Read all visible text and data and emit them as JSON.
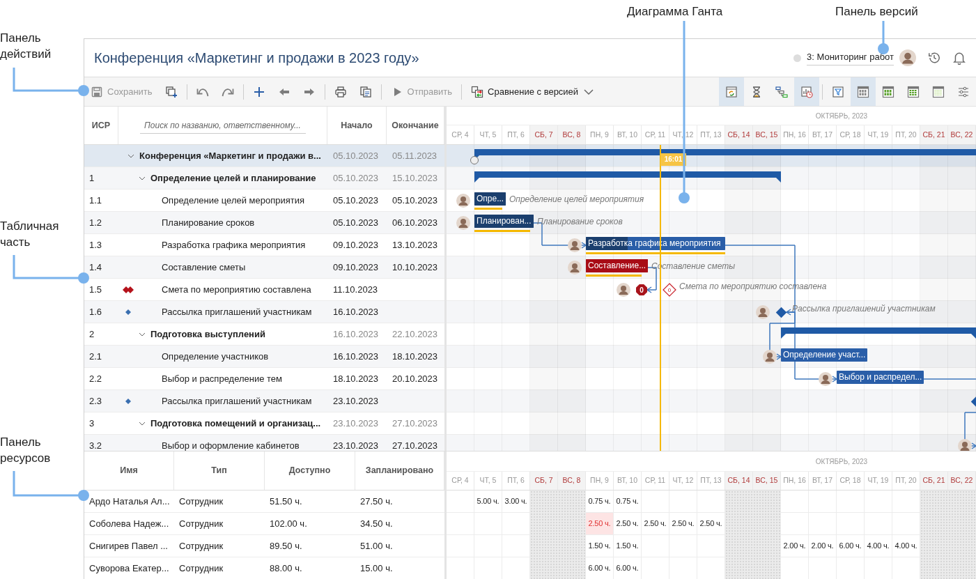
{
  "callouts": [
    {
      "kind": "toolbar",
      "text": "Панель действий"
    },
    {
      "kind": "table",
      "text": "Табличная часть"
    },
    {
      "kind": "resources",
      "text": "Панель ресурсов"
    },
    {
      "kind": "gantt",
      "text": "Диаграмма Ганта"
    },
    {
      "kind": "versions",
      "text": "Панель версий"
    }
  ],
  "header": {
    "title": "Конференция «Маркетинг и продажи в 2023 году»",
    "version": "3: Мониторинг работ"
  },
  "toolbar": {
    "left": [
      [
        {
          "kind": "save",
          "label": "Сохранить",
          "disabled": true
        },
        {
          "kind": "add-copy",
          "disabled": false
        }
      ],
      [
        {
          "kind": "undo",
          "disabled": true
        },
        {
          "kind": "redo",
          "disabled": true
        }
      ],
      [
        {
          "kind": "add",
          "disabled": false
        },
        {
          "kind": "outdent",
          "disabled": true
        },
        {
          "kind": "indent",
          "disabled": true
        }
      ],
      [
        {
          "kind": "print",
          "disabled": false
        },
        {
          "kind": "copy",
          "disabled": false
        }
      ],
      [
        {
          "kind": "send",
          "label": "Отправить",
          "disabled": true
        }
      ],
      [
        {
          "kind": "compare",
          "label": "Сравнение с версией",
          "disabled": false
        }
      ]
    ],
    "right": [
      [
        {
          "kind": "refresh",
          "selected": true
        },
        {
          "kind": "hourglass",
          "selected": false
        },
        {
          "kind": "links",
          "selected": false
        },
        {
          "kind": "chartclock",
          "selected": true
        }
      ],
      [
        {
          "kind": "filter",
          "selected": false
        },
        {
          "kind": "grid-a",
          "selected": true
        },
        {
          "kind": "grid-b",
          "selected": false
        },
        {
          "kind": "grid-c",
          "selected": false
        },
        {
          "kind": "grid-d",
          "selected": false
        },
        {
          "kind": "sliders",
          "selected": false
        }
      ]
    ]
  },
  "table": {
    "columns": [
      {
        "kind": "text",
        "label": "ИСР"
      },
      {
        "kind": "search",
        "placeholder": "Поиск по названию, ответственному..."
      },
      {
        "kind": "text",
        "label": "Начало"
      },
      {
        "kind": "text",
        "label": "Окончание"
      }
    ],
    "tasks": [
      {
        "kind": "summary",
        "name": "Конференция «Маркетинг и продажи в...",
        "start": "05.10.2023",
        "end": "05.11.2023",
        "expanded": true,
        "selected": true,
        "start_marker": true,
        "children": [
          {
            "kind": "summary",
            "wbs": "1",
            "name": "Определение целей и планирование",
            "start": "05.10.2023",
            "end": "15.10.2023",
            "expanded": true,
            "selected": false,
            "children": [
              {
                "kind": "task",
                "wbs": "1.1",
                "name": "Определение целей мероприятия",
                "start": "05.10.2023",
                "end": "05.10.2023",
                "selected": false,
                "avatar": true,
                "bar": {
                  "label": "Опре...",
                  "level": 1,
                  "overdue": false,
                  "note": "Определение целей мероприятия",
                  "baseline": true
                }
              },
              {
                "kind": "task",
                "wbs": "1.2",
                "name": "Планирование сроков",
                "start": "05.10.2023",
                "end": "06.10.2023",
                "selected": false,
                "avatar": true,
                "bar": {
                  "label": "Планирован...",
                  "level": 1,
                  "overdue": false,
                  "note": "Планирование сроков",
                  "baseline": true
                }
              },
              {
                "kind": "task",
                "wbs": "1.3",
                "name": "Разработка графика мероприятия",
                "start": "09.10.2023",
                "end": "13.10.2023",
                "selected": false,
                "avatar": true,
                "bar": {
                  "label": "Разработка графика мероприятия",
                  "level": 0.3,
                  "overdue": false,
                  "baseline": true
                }
              },
              {
                "kind": "task",
                "wbs": "1.4",
                "name": "Составление сметы",
                "start": "09.10.2023",
                "end": "10.10.2023",
                "selected": false,
                "avatar": true,
                "bar": {
                  "label": "Составление...",
                  "level": 1,
                  "overdue": true,
                  "note": "Составление сметы",
                  "baseline": true
                }
              },
              {
                "kind": "milestone",
                "wbs": "1.5",
                "name": "Смета по мероприятию составлена",
                "start": "11.10.2023",
                "selected": false,
                "critical": true,
                "avatar": true,
                "bar": {
                  "badge": "0",
                  "note": "Смета по мероприятию составлена",
                  "baseline": {
                    "badge": "0"
                  }
                }
              },
              {
                "kind": "milestone",
                "wbs": "1.6",
                "name": "Рассылка приглашений участникам",
                "start": "16.10.2023",
                "selected": false,
                "critical": false,
                "avatar": true,
                "bar": {
                  "note": "Рассылка приглашений участникам"
                }
              }
            ]
          },
          {
            "kind": "summary",
            "wbs": "2",
            "name": "Подготовка выступлений",
            "start": "16.10.2023",
            "end": "22.10.2023",
            "expanded": true,
            "selected": false,
            "children": [
              {
                "kind": "task",
                "wbs": "2.1",
                "name": "Определение участников",
                "start": "16.10.2023",
                "end": "18.10.2023",
                "selected": false,
                "avatar": true,
                "bar": {
                  "label": "Определение участ...",
                  "overdue": false
                }
              },
              {
                "kind": "task",
                "wbs": "2.2",
                "name": "Выбор и распределение тем",
                "start": "18.10.2023",
                "end": "20.10.2023",
                "selected": false,
                "avatar": true,
                "bar": {
                  "label": "Выбор и распредел...",
                  "overdue": false
                }
              },
              {
                "kind": "milestone",
                "wbs": "2.3",
                "name": "Рассылка приглашений участникам",
                "start": "23.10.2023",
                "selected": false,
                "critical": false,
                "avatar": false
              }
            ]
          },
          {
            "kind": "summary",
            "wbs": "3",
            "name": "Подготовка помещений и организац...",
            "start": "23.10.2023",
            "end": "27.10.2023",
            "expanded": true,
            "selected": false,
            "children": [
              {
                "kind": "task",
                "wbs": "3.2",
                "name": "Выбор и оформление кабинетов",
                "start": "23.10.2023",
                "end": "27.10.2023",
                "selected": false,
                "avatar": true
              }
            ]
          }
        ]
      }
    ]
  },
  "gantt": {
    "month": "ОКТЯБРЬ, 2023",
    "days": [
      {
        "label": "СР, 4",
        "weekend": false,
        "today": false
      },
      {
        "label": "ЧТ, 5",
        "weekend": false,
        "today": false
      },
      {
        "label": "ПТ, 6",
        "weekend": false,
        "today": false
      },
      {
        "label": "СБ, 7",
        "weekend": true,
        "today": false
      },
      {
        "label": "ВС, 8",
        "weekend": true,
        "today": false
      },
      {
        "label": "ПН, 9",
        "weekend": false,
        "today": false
      },
      {
        "label": "ВТ, 10",
        "weekend": false,
        "today": false
      },
      {
        "label": "СР, 11",
        "weekend": false,
        "today": true
      },
      {
        "label": "ЧТ, 12",
        "weekend": false,
        "today": false
      },
      {
        "label": "ПТ, 13",
        "weekend": false,
        "today": false
      },
      {
        "label": "СБ, 14",
        "weekend": true,
        "today": false
      },
      {
        "label": "ВС, 15",
        "weekend": true,
        "today": false
      },
      {
        "label": "ПН, 16",
        "weekend": false,
        "today": false
      },
      {
        "label": "ВТ, 17",
        "weekend": false,
        "today": false
      },
      {
        "label": "СР, 18",
        "weekend": false,
        "today": false
      },
      {
        "label": "ЧТ, 19",
        "weekend": false,
        "today": false
      },
      {
        "label": "ПТ, 20",
        "weekend": false,
        "today": false
      },
      {
        "label": "СБ, 21",
        "weekend": true,
        "today": false
      },
      {
        "label": "ВС, 22",
        "weekend": true,
        "today": false
      }
    ],
    "now": {
      "time": "16:01"
    }
  },
  "resources": {
    "columns": [
      "Имя",
      "Тип",
      "Доступно",
      "Запланировано"
    ],
    "month": "ОКТЯБРЬ, 2023",
    "days": [
      {
        "label": "СР, 4",
        "weekend": false
      },
      {
        "label": "ЧТ, 5",
        "weekend": false
      },
      {
        "label": "ПТ, 6",
        "weekend": false
      },
      {
        "label": "СБ, 7",
        "weekend": true
      },
      {
        "label": "ВС, 8",
        "weekend": true
      },
      {
        "label": "ПН, 9",
        "weekend": false
      },
      {
        "label": "ВТ, 10",
        "weekend": false
      },
      {
        "label": "СР, 11",
        "weekend": false
      },
      {
        "label": "ЧТ, 12",
        "weekend": false
      },
      {
        "label": "ПТ, 13",
        "weekend": false
      },
      {
        "label": "СБ, 14",
        "weekend": true
      },
      {
        "label": "ВС, 15",
        "weekend": true
      },
      {
        "label": "ПН, 16",
        "weekend": false
      },
      {
        "label": "ВТ, 17",
        "weekend": false
      },
      {
        "label": "СР, 18",
        "weekend": false
      },
      {
        "label": "ЧТ, 19",
        "weekend": false
      },
      {
        "label": "ПТ, 20",
        "weekend": false
      },
      {
        "label": "СБ, 21",
        "weekend": true
      },
      {
        "label": "ВС, 22",
        "weekend": true
      }
    ],
    "rows": [
      {
        "name": "Ардо Наталья Ал...",
        "type": "Сотрудник",
        "available": "51.50 ч.",
        "planned": "27.50 ч.",
        "hours": [
          {
            "overloaded": false
          },
          {
            "text": "5.00 ч.",
            "overloaded": false
          },
          {
            "text": "3.00 ч.",
            "overloaded": false
          },
          {
            "overloaded": false
          },
          {
            "overloaded": false
          },
          {
            "text": "0.75 ч.",
            "overloaded": false
          },
          {
            "text": "0.75 ч.",
            "overloaded": false
          },
          {
            "overloaded": false
          },
          {
            "overloaded": false
          },
          {
            "overloaded": false
          },
          {
            "overloaded": false
          },
          {
            "overloaded": false
          },
          {
            "overloaded": false
          },
          {
            "overloaded": false
          },
          {
            "overloaded": false
          },
          {
            "overloaded": false
          },
          {
            "overloaded": false
          },
          {
            "overloaded": false
          },
          {
            "overloaded": false
          }
        ]
      },
      {
        "name": "Соболева Надеж...",
        "type": "Сотрудник",
        "available": "102.00 ч.",
        "planned": "34.50 ч.",
        "hours": [
          {
            "overloaded": false
          },
          {
            "overloaded": false
          },
          {
            "overloaded": false
          },
          {
            "overloaded": false
          },
          {
            "overloaded": false
          },
          {
            "text": "2.50 ч.",
            "overloaded": true
          },
          {
            "text": "2.50 ч.",
            "overloaded": false
          },
          {
            "text": "2.50 ч.",
            "overloaded": false
          },
          {
            "text": "2.50 ч.",
            "overloaded": false
          },
          {
            "text": "2.50 ч.",
            "overloaded": false
          },
          {
            "overloaded": false
          },
          {
            "overloaded": false
          },
          {
            "overloaded": false
          },
          {
            "overloaded": false
          },
          {
            "overloaded": false
          },
          {
            "overloaded": false
          },
          {
            "overloaded": false
          },
          {
            "overloaded": false
          },
          {
            "overloaded": false
          }
        ]
      },
      {
        "name": "Снигирев Павел ...",
        "type": "Сотрудник",
        "available": "89.50 ч.",
        "planned": "51.00 ч.",
        "hours": [
          {
            "overloaded": false
          },
          {
            "overloaded": false
          },
          {
            "overloaded": false
          },
          {
            "overloaded": false
          },
          {
            "overloaded": false
          },
          {
            "text": "1.50 ч.",
            "overloaded": false
          },
          {
            "text": "1.50 ч.",
            "overloaded": false
          },
          {
            "overloaded": false
          },
          {
            "overloaded": false
          },
          {
            "overloaded": false
          },
          {
            "overloaded": false
          },
          {
            "overloaded": false
          },
          {
            "text": "2.00 ч.",
            "overloaded": false
          },
          {
            "text": "2.00 ч.",
            "overloaded": false
          },
          {
            "text": "6.00 ч.",
            "overloaded": false
          },
          {
            "text": "4.00 ч.",
            "overloaded": false
          },
          {
            "text": "4.00 ч.",
            "overloaded": false
          },
          {
            "overloaded": false
          },
          {
            "overloaded": false
          }
        ]
      },
      {
        "name": "Суворова Екатер...",
        "type": "Сотрудник",
        "available": "88.00 ч.",
        "planned": "15.00 ч.",
        "hours": [
          {
            "overloaded": false
          },
          {
            "overloaded": false
          },
          {
            "overloaded": false
          },
          {
            "overloaded": false
          },
          {
            "overloaded": false
          },
          {
            "text": "6.00 ч.",
            "overloaded": false
          },
          {
            "text": "6.00 ч.",
            "overloaded": false
          },
          {
            "overloaded": false
          },
          {
            "overloaded": false
          },
          {
            "overloaded": false
          },
          {
            "overloaded": false
          },
          {
            "overloaded": false
          },
          {
            "overloaded": false
          },
          {
            "overloaded": false
          },
          {
            "overloaded": false
          },
          {
            "overloaded": false
          },
          {
            "overloaded": false
          },
          {
            "overloaded": false
          },
          {
            "overloaded": false
          }
        ]
      }
    ]
  }
}
